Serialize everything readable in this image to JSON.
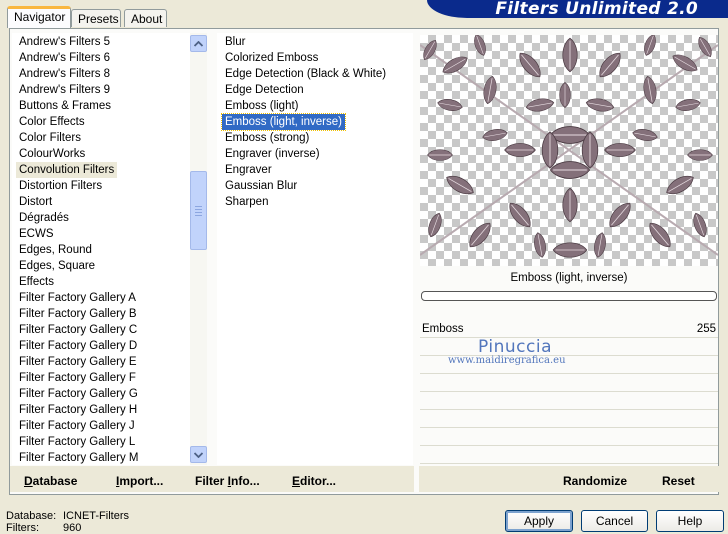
{
  "tabs": [
    {
      "label": "Navigator",
      "active": true
    },
    {
      "label": "Presets",
      "active": false
    },
    {
      "label": "About",
      "active": false
    }
  ],
  "banner_title": "Filters Unlimited 2.0",
  "categories": [
    "Andrew's Filters 5",
    "Andrew's Filters 6",
    "Andrew's Filters 8",
    "Andrew's Filters 9",
    "Buttons & Frames",
    "Color Effects",
    "Color Filters",
    "ColourWorks",
    "Convolution Filters",
    "Distortion Filters",
    "Distort",
    "Dégradés",
    "ECWS",
    "Edges, Round",
    "Edges, Square",
    "Effects",
    "Filter Factory Gallery A",
    "Filter Factory Gallery B",
    "Filter Factory Gallery C",
    "Filter Factory Gallery D",
    "Filter Factory Gallery E",
    "Filter Factory Gallery F",
    "Filter Factory Gallery G",
    "Filter Factory Gallery H",
    "Filter Factory Gallery J",
    "Filter Factory Gallery L",
    "Filter Factory Gallery M"
  ],
  "selected_category": "Convolution Filters",
  "filters": [
    "Blur",
    "Colorized Emboss",
    "Edge Detection (Black & White)",
    "Edge Detection",
    "Emboss (light)",
    "Emboss (light, inverse)",
    "Emboss (strong)",
    "Engraver (inverse)",
    "Engraver",
    "Gaussian Blur",
    "Sharpen"
  ],
  "selected_filter": "Emboss (light, inverse)",
  "preview": {
    "filter_name": "Emboss (light, inverse)",
    "progress": 0
  },
  "params": [
    {
      "name": "Emboss",
      "value": "255"
    }
  ],
  "watermark": {
    "line1": "Pinuccia",
    "line2": "www.maidiregrafica.eu"
  },
  "left_links": [
    {
      "pre": "",
      "u": "D",
      "post": "atabase"
    },
    {
      "pre": "",
      "u": "I",
      "post": "mport..."
    },
    {
      "pre": "Filter ",
      "u": "I",
      "post": "nfo..."
    },
    {
      "pre": "",
      "u": "E",
      "post": "ditor..."
    }
  ],
  "right_links": {
    "randomize": "Randomize",
    "reset": "Reset"
  },
  "info": {
    "database_label": "Database:",
    "database_value": "ICNET-Filters",
    "filters_label": "Filters:",
    "filters_value": "960"
  },
  "buttons": {
    "apply": "Apply",
    "cancel": "Cancel",
    "help": "Help"
  },
  "colors": {
    "selection": "#316ac5",
    "banner": "#0a2a8c",
    "leaf": "#84707a"
  }
}
